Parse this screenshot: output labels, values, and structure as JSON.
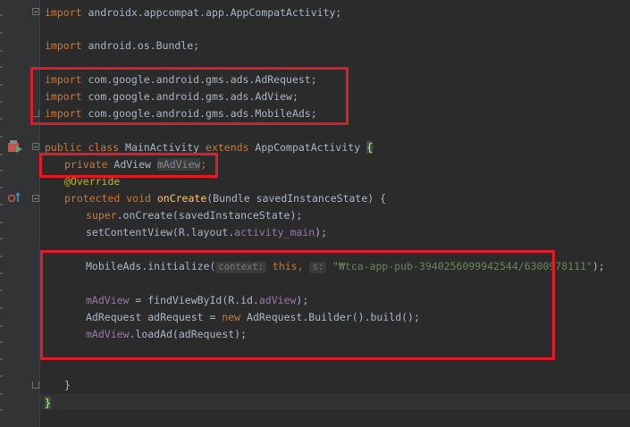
{
  "editor": {
    "lines": {
      "import1": {
        "kw": "import",
        "text": " androidx.appcompat.app.AppCompatActivity;"
      },
      "import2": {
        "kw": "import",
        "text": " android.os.Bundle;"
      },
      "import3": {
        "kw": "import",
        "text": " com.google.android.gms.ads.AdRequest;"
      },
      "import4": {
        "kw": "import",
        "text": " com.google.android.gms.ads.AdView;"
      },
      "import5": {
        "kw": "import",
        "text": " com.google.android.gms.ads.MobileAds;"
      },
      "class_decl": {
        "kw1": "public class",
        "name": " MainActivity ",
        "kw2": "extends",
        "parent": " AppCompatActivity ",
        "brace": "{"
      },
      "field_decl": {
        "kw": "private",
        "type": " AdView ",
        "name": "mAdView",
        "semi": ";"
      },
      "annotation": "@Override",
      "method_decl": {
        "kw": "protected void",
        "name": " onCreate",
        "params": "(Bundle savedInstanceState) {"
      },
      "super_call": {
        "kw": "super",
        "text": ".onCreate(savedInstanceState);"
      },
      "set_content": {
        "text1": "setContentView(R.layout.",
        "field": "activity_main",
        "text2": ");"
      },
      "init_call": {
        "text1": "MobileAds.initialize(",
        "hint1": "context:",
        "kw": " this",
        "comma": ", ",
        "hint2": "s:",
        "str": " \"₩tca-app-pub-3940256099942544/6300978111\"",
        "text2": ");"
      },
      "find_view": {
        "field1": "mAdView",
        "text1": " = findViewById(R.id.",
        "field2": "adView",
        "text2": ");"
      },
      "ad_request": {
        "text1": "AdRequest adRequest = ",
        "kw": "new",
        "text2": " AdRequest.Builder().build();"
      },
      "load_ad": {
        "field": "mAdView",
        "text": ".loadAd(adRequest);"
      },
      "close_method": "}",
      "close_class": "}"
    }
  },
  "colors": {
    "background": "#2b2b2b",
    "keyword": "#cc7832",
    "method": "#ffc66d",
    "field": "#9876aa",
    "string": "#6a8759",
    "annotation": "#bbb529",
    "highlight_box": "#e21c26"
  },
  "gutter_icons": [
    "run-class-icon",
    "override-method-icon"
  ]
}
